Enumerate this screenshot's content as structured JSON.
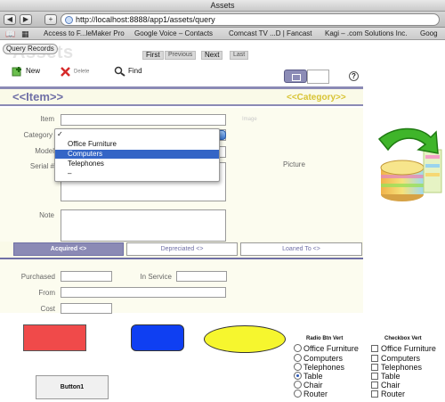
{
  "window": {
    "title": "Assets"
  },
  "browser": {
    "url": "http://localhost:8888/app1/assets/query",
    "bookmarks": [
      "Access to F...leMaker Pro",
      "Google Voice – Contacts",
      "Comcast TV ...D | Fancast",
      "Kagi – .com Solutions Inc.",
      "Goog"
    ]
  },
  "header": {
    "query_records": "Query Records",
    "app_title": "Assets",
    "nav": {
      "first": "First",
      "previous": "Previous",
      "next": "Next",
      "last": "Last"
    },
    "actions": {
      "new": "New",
      "delete": "Delete",
      "find": "Find"
    },
    "help": "?"
  },
  "record": {
    "item_title": "<<Item>>",
    "category_title": "<<Category>>",
    "labels": {
      "item": "Item",
      "category": "Category",
      "model": "Model",
      "serial": "Serial #",
      "note": "Note",
      "image": "Image",
      "picture": "Picture"
    },
    "category_options": [
      "Office Furniture",
      "Computers",
      "Telephones",
      "–"
    ],
    "selected_option": "Computers",
    "check_glyph": "✓"
  },
  "tabs": [
    "Acquired <>",
    "Depreciated <>",
    "Loaned To <>"
  ],
  "acquired": {
    "purchased": "Purchased",
    "in_service": "In Service",
    "from": "From",
    "cost": "Cost"
  },
  "controls": {
    "button1": "Button1",
    "radio_title": "Radio Btn Vert",
    "checkbox_title": "Checkbox Vert",
    "radio_options": [
      "Office Furniture",
      "Computers",
      "Telephones",
      "Table",
      "Chair",
      "Router"
    ],
    "radio_selected": "Table",
    "checkbox_options": [
      "Office Furniture",
      "Computers",
      "Telephones",
      "Table",
      "Chair",
      "Router"
    ]
  },
  "colors": {
    "accent": "#8b8ab5",
    "category_title": "#d8c332",
    "red_shape": "#f04a4a",
    "blue_shape": "#0f3ff2",
    "yellow_shape": "#f6f62e",
    "selection": "#3465c6"
  }
}
